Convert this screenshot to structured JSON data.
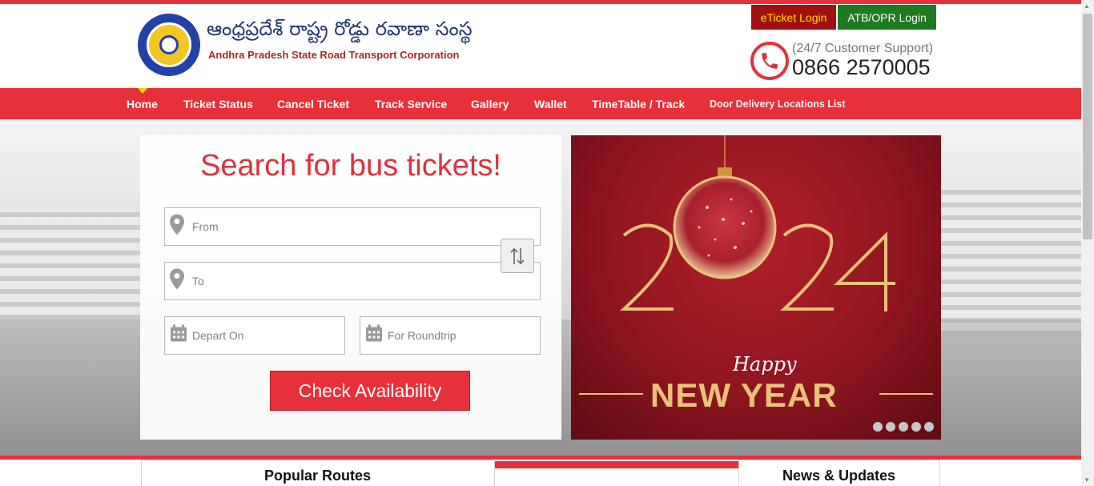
{
  "brand": {
    "name_telugu": "ఆంధ్రప్రదేశ్ రాష్ట్ర రోడ్డు రవాణా సంస్థ",
    "name_english": "Andhra Pradesh State Road Transport Corporation"
  },
  "header": {
    "eticket_login": "eTicket Login",
    "atb_login": "ATB/OPR Login",
    "support_label": "(24/7 Customer Support)",
    "support_phone": "0866 2570005"
  },
  "nav": {
    "items": [
      {
        "label": "Home",
        "active": true
      },
      {
        "label": "Ticket Status"
      },
      {
        "label": "Cancel Ticket"
      },
      {
        "label": "Track Service"
      },
      {
        "label": "Gallery"
      },
      {
        "label": "Wallet"
      },
      {
        "label": "TimeTable / Track"
      },
      {
        "label": "Door Delivery Locations List"
      }
    ]
  },
  "search": {
    "title": "Search for bus tickets!",
    "from_placeholder": "From",
    "to_placeholder": "To",
    "depart_placeholder": "Depart On",
    "roundtrip_placeholder": "For Roundtrip",
    "submit_label": "Check Availability"
  },
  "banner": {
    "year": "2024",
    "happy": "Happy",
    "new_year": "NEW YEAR",
    "slide_count": 5,
    "background_color": "#8f1520",
    "accent_color": "#e8c27a"
  },
  "bottom": {
    "popular_routes": "Popular Routes",
    "news_updates": "News & Updates"
  },
  "colors": {
    "brand_red": "#e8303a",
    "eticket_bg": "#a01010",
    "atb_bg": "#1f7a1f"
  }
}
